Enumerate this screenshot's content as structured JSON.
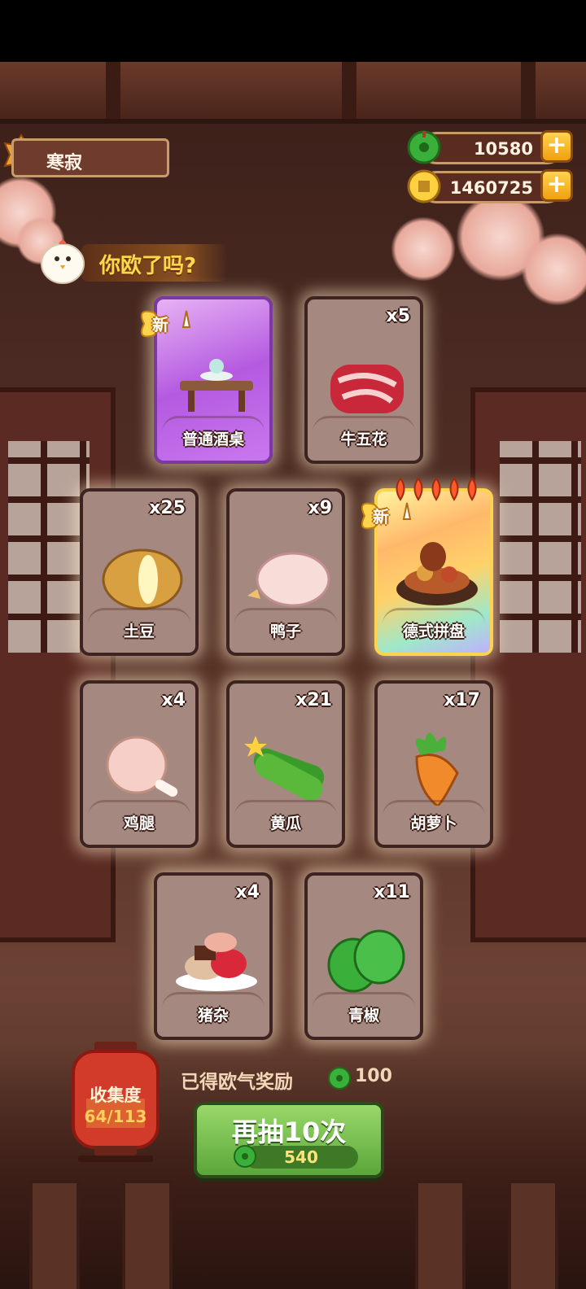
{
  "header": {
    "player_name": "寒寂",
    "currency_jade": "10580",
    "currency_coins": "1460725",
    "title": "你欧了吗?"
  },
  "cards": [
    {
      "name": "普通酒桌",
      "count": "",
      "is_new": true,
      "rarity": "purple",
      "icon": "wine-table-icon"
    },
    {
      "name": "牛五花",
      "count": "x5",
      "is_new": false,
      "rarity": "normal",
      "icon": "beef-icon"
    },
    {
      "name": "土豆",
      "count": "x25",
      "is_new": false,
      "rarity": "normal",
      "icon": "potato-icon"
    },
    {
      "name": "鸭子",
      "count": "x9",
      "is_new": false,
      "rarity": "normal",
      "icon": "duck-icon"
    },
    {
      "name": "德式拼盘",
      "count": "",
      "is_new": true,
      "rarity": "rainbow",
      "icon": "german-platter-icon"
    },
    {
      "name": "鸡腿",
      "count": "x4",
      "is_new": false,
      "rarity": "normal",
      "icon": "chicken-leg-icon"
    },
    {
      "name": "黄瓜",
      "count": "x21",
      "is_new": false,
      "rarity": "normal",
      "icon": "cucumber-icon"
    },
    {
      "name": "胡萝卜",
      "count": "x17",
      "is_new": false,
      "rarity": "normal",
      "icon": "carrot-icon"
    },
    {
      "name": "猪杂",
      "count": "x4",
      "is_new": false,
      "rarity": "normal",
      "icon": "pork-offal-icon"
    },
    {
      "name": "青椒",
      "count": "x11",
      "is_new": false,
      "rarity": "normal",
      "icon": "green-pepper-icon"
    }
  ],
  "new_label": "新",
  "collection": {
    "label": "收集度",
    "value": "64/113"
  },
  "reward": {
    "text": "已得欧气奖励",
    "amount": "100"
  },
  "draw_button": {
    "label": "再抽10次",
    "cost": "540"
  },
  "colors": {
    "jade": "#2e9a2a",
    "gold": "#f0b020",
    "button_green": "#6ab84a"
  }
}
